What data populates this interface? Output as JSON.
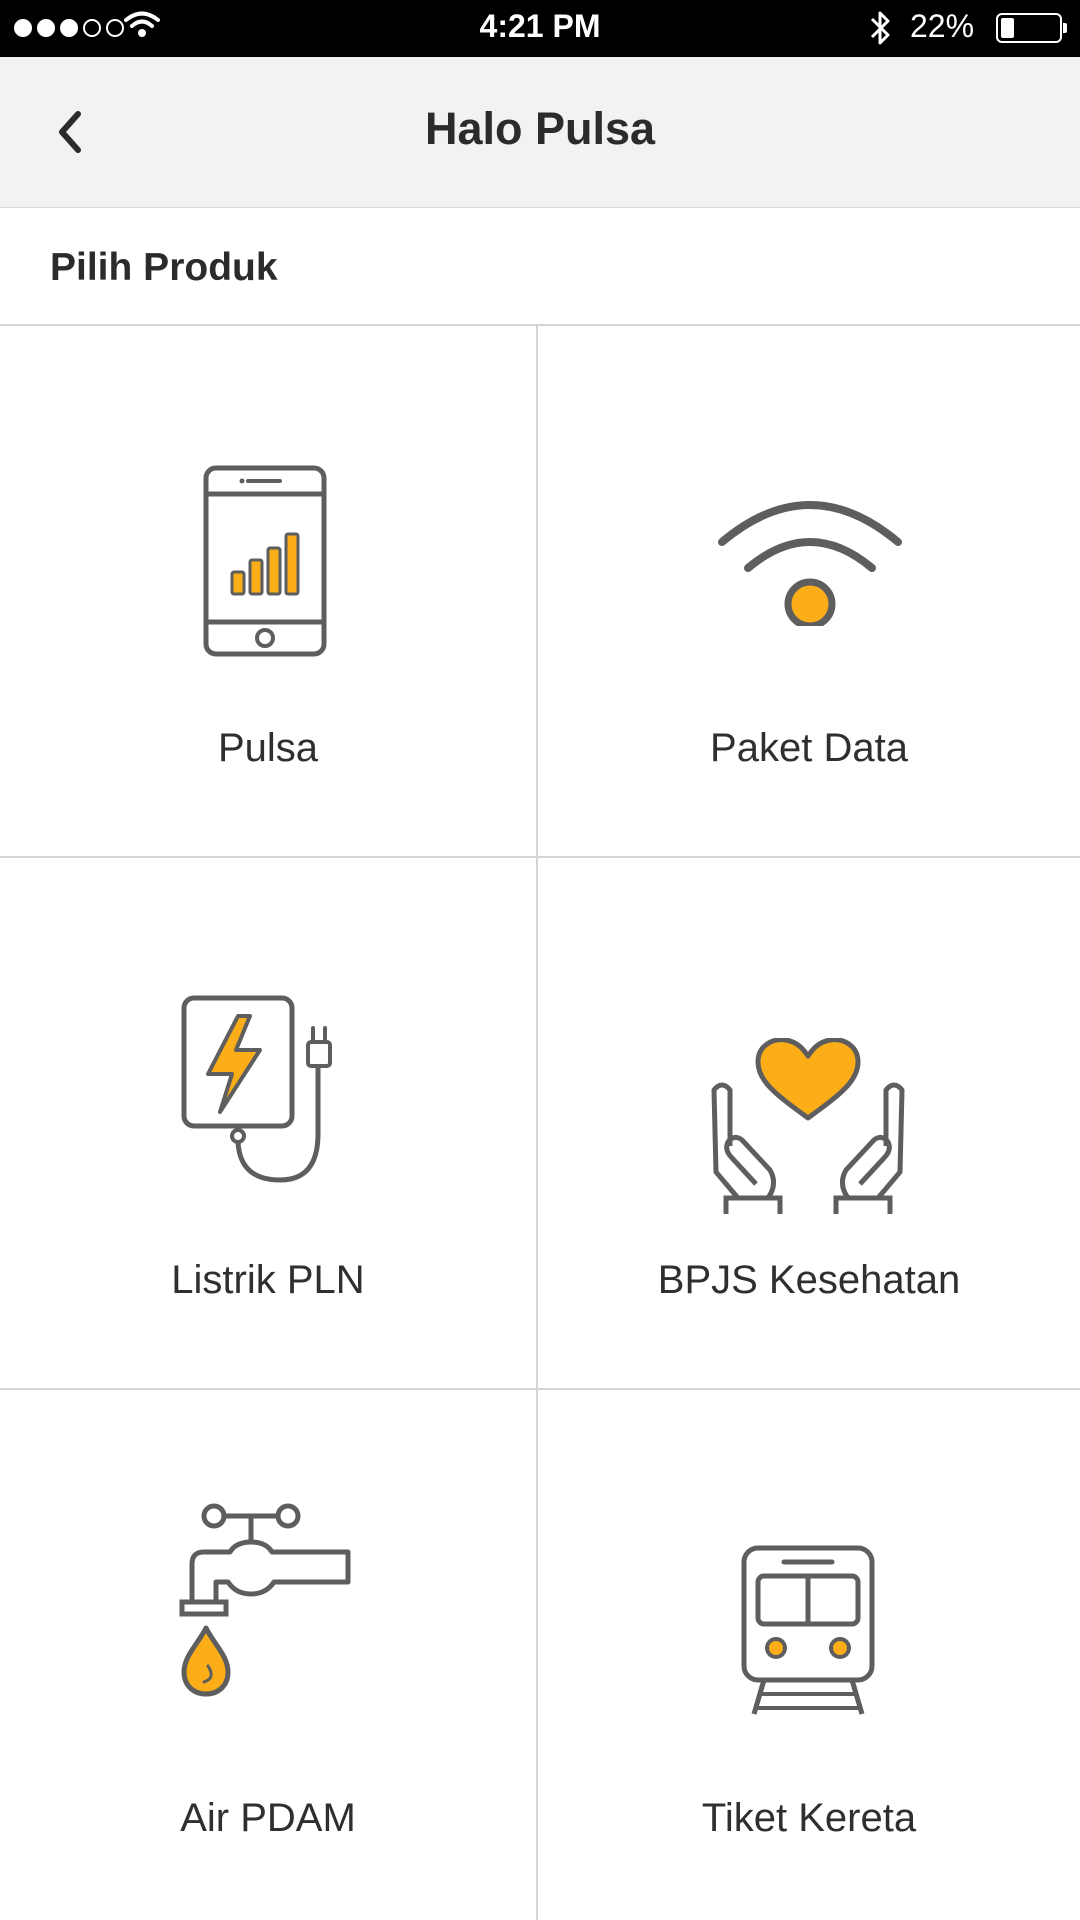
{
  "status_bar": {
    "time": "4:21 PM",
    "battery": "22%",
    "battery_level": 0.22,
    "signal_bars_filled": 3,
    "signal_bars_total": 5
  },
  "nav": {
    "title": "Halo Pulsa",
    "back_icon": "chevron-left-icon"
  },
  "section": {
    "title": "Pilih Produk"
  },
  "products": [
    {
      "label": "Pulsa",
      "icon": "phone-signal-icon"
    },
    {
      "label": "Paket Data",
      "icon": "wifi-icon"
    },
    {
      "label": "Listrik PLN",
      "icon": "electric-plug-icon"
    },
    {
      "label": "BPJS Kesehatan",
      "icon": "heart-hands-icon"
    },
    {
      "label": "Air PDAM",
      "icon": "water-tap-icon"
    },
    {
      "label": "Tiket Kereta",
      "icon": "train-icon"
    }
  ],
  "colors": {
    "accent": "#FBAE17",
    "icon_stroke": "#5E5E5E",
    "nav_bg": "#F2F2F2",
    "divider": "#D4D4D4"
  }
}
